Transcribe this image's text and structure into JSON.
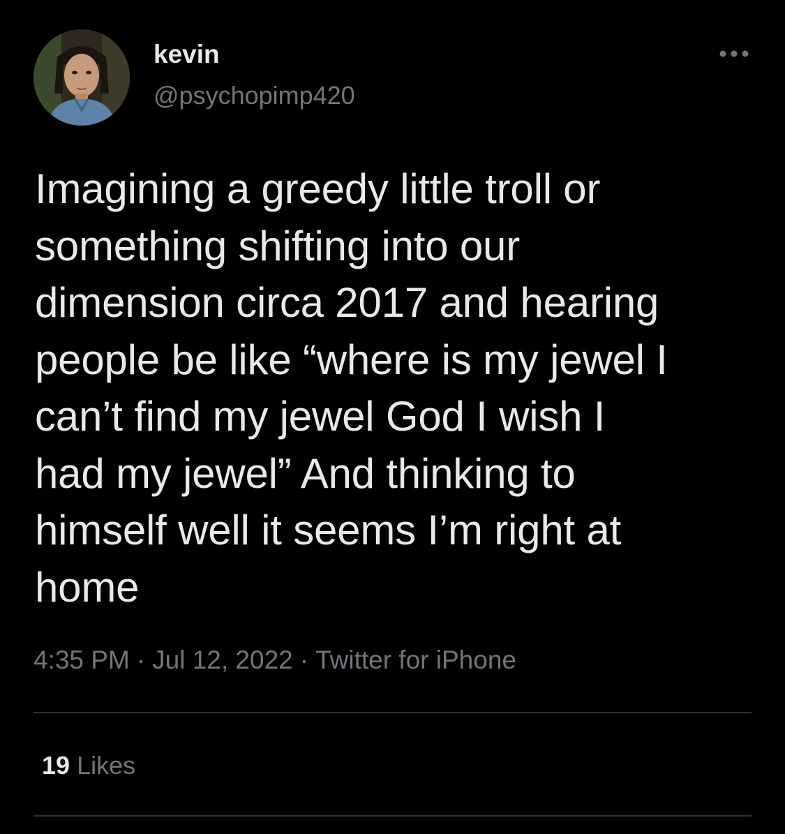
{
  "user": {
    "display_name": "kevin",
    "handle": "@psychopimp420"
  },
  "tweet": {
    "text": "Imagining a greedy little troll or\nsomething shifting into our\ndimension circa 2017 and hearing\npeople be like “where is my jewel I\ncan’t find my jewel God I wish I\nhad my jewel” And thinking to\nhimself well it seems I’m right at\nhome",
    "time": "4:35 PM",
    "separator": "·",
    "date": "Jul 12, 2022",
    "source": "Twitter for iPhone"
  },
  "stats": {
    "likes_count": "19",
    "likes_label": "Likes"
  },
  "icons": {
    "avatar": "avatar-photo",
    "more": "more-options-icon"
  },
  "colors": {
    "background": "#000000",
    "text_primary": "#e7e9ea",
    "text_secondary": "#71767b",
    "divider": "#2f3336"
  }
}
